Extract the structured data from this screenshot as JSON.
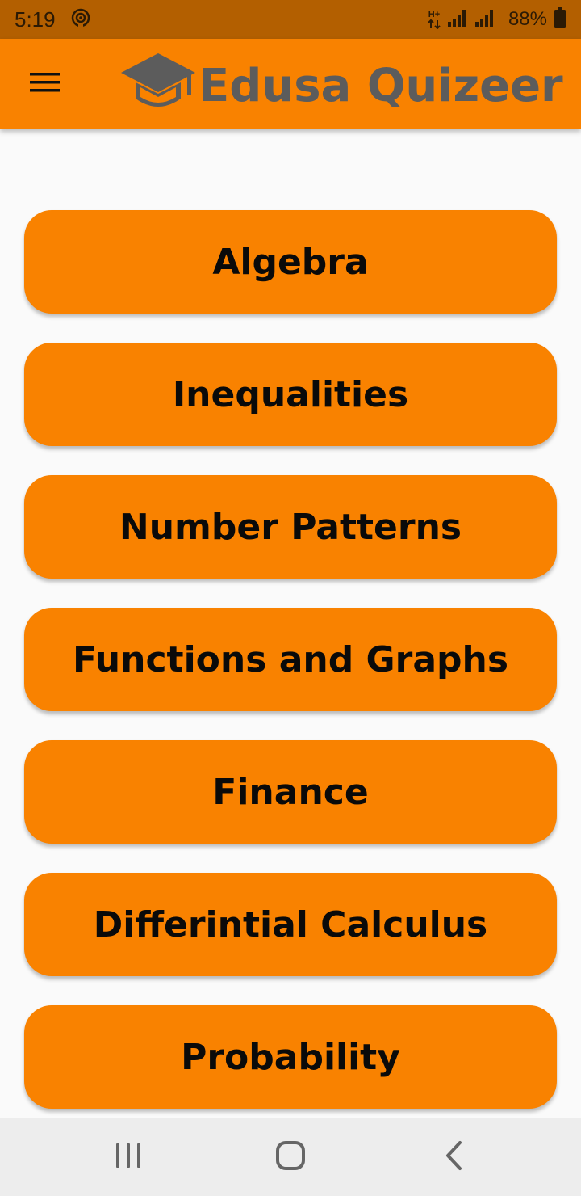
{
  "status_bar": {
    "time": "5:19",
    "battery_text": "88%",
    "network_label": "H+"
  },
  "app_bar": {
    "title": "Edusa Quizeer",
    "menu_icon": "hamburger-menu-icon",
    "logo_icon": "graduation-cap-icon"
  },
  "topics": [
    {
      "label": "Algebra"
    },
    {
      "label": "Inequalities"
    },
    {
      "label": "Number Patterns"
    },
    {
      "label": "Functions and Graphs"
    },
    {
      "label": "Finance"
    },
    {
      "label": "Differintial Calculus"
    },
    {
      "label": "Probability"
    }
  ],
  "nav_bar": {
    "recents_icon": "recents-icon",
    "home_icon": "home-icon",
    "back_icon": "back-icon"
  },
  "colors": {
    "accent": "#f98200",
    "status_bar": "#b35f00",
    "logo_gray": "#5c5c5c",
    "background": "#fafafa"
  }
}
